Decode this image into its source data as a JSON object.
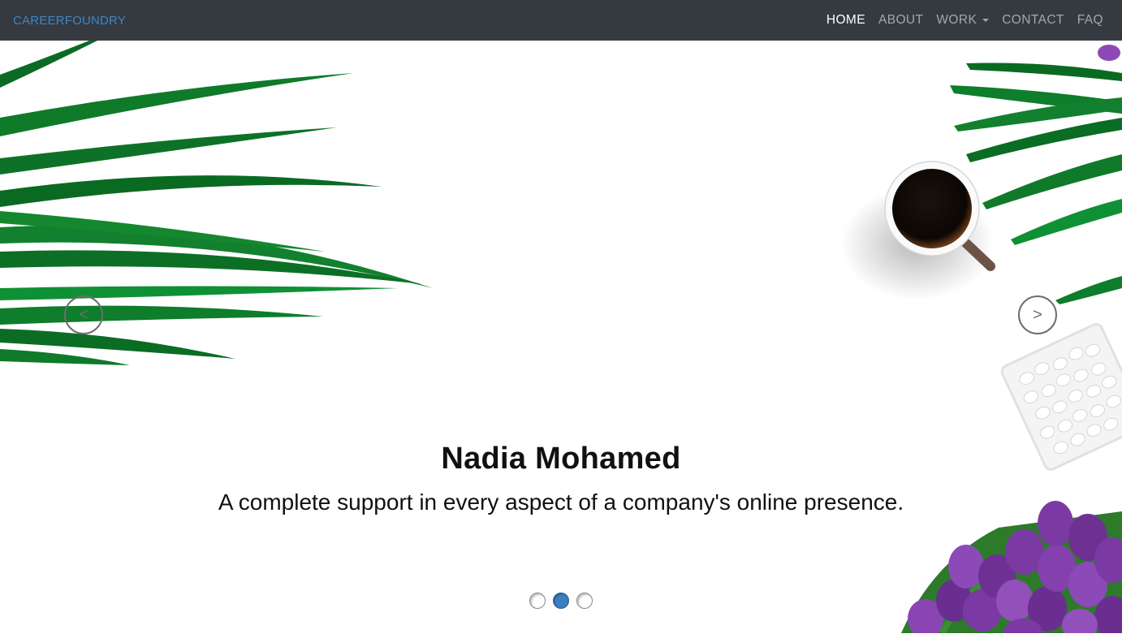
{
  "nav": {
    "brand": "CAREERFOUNDRY",
    "items": [
      {
        "label": "HOME",
        "active": true
      },
      {
        "label": "ABOUT",
        "active": false
      },
      {
        "label": "WORK",
        "active": false,
        "dropdown": true
      },
      {
        "label": "CONTACT",
        "active": false
      },
      {
        "label": "FAQ",
        "active": false
      }
    ]
  },
  "hero": {
    "title": "Nadia Mohamed",
    "subtitle": "A complete support in every aspect of a company's online presence.",
    "prev_label": "<",
    "next_label": ">",
    "slide_count": 3,
    "active_slide": 2
  },
  "colors": {
    "navbar_bg": "#343a40",
    "brand": "#3f86c4",
    "active_dot": "#3a7fc0",
    "leaf_green": "#0f7a2a",
    "tulip_purple": "#7b3aa3"
  },
  "icons": [
    "palm-leaves-image",
    "coffee-cup-image",
    "mints-bowl-image",
    "tulips-image",
    "chevron-left-icon",
    "chevron-right-icon"
  ]
}
